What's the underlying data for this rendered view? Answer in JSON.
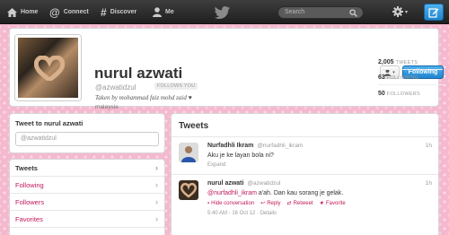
{
  "topbar": {
    "nav": [
      {
        "label": "Home",
        "icon": "home-icon"
      },
      {
        "label": "Connect",
        "icon": "at-icon"
      },
      {
        "label": "Discover",
        "icon": "hash-icon"
      },
      {
        "label": "Me",
        "icon": "person-icon"
      }
    ],
    "search_placeholder": "Search",
    "colors": {
      "bar": "#2b2b2b",
      "accent": "#1e84cd"
    }
  },
  "profile": {
    "name": "nurul azwati",
    "handle": "@azwatidzul",
    "follows_you": "FOLLOWS YOU",
    "bio": "Taken by mohammad faiz mohd zaid ♥",
    "location": "malaysia",
    "follow_label": "Following",
    "stats": [
      {
        "value": "2,005",
        "label": "TWEETS"
      },
      {
        "value": "63",
        "label": "FOLLOWING"
      },
      {
        "value": "50",
        "label": "FOLLOWERS"
      }
    ]
  },
  "tweet_to": {
    "title": "Tweet to nurul azwati",
    "placeholder": "@azwatidzul"
  },
  "sidenav": {
    "items": [
      {
        "label": "Tweets",
        "active": true
      },
      {
        "label": "Following",
        "active": false
      },
      {
        "label": "Followers",
        "active": false
      },
      {
        "label": "Favorites",
        "active": false
      }
    ],
    "link_color": "#c2185b"
  },
  "timeline": {
    "title": "Tweets",
    "tweets": [
      {
        "name": "Nurfadhli Ikram",
        "handle": "@nurfadhli_ikram",
        "time": "1h",
        "text": "Aku je ke layan bola ni?",
        "expand": "Expand"
      },
      {
        "name": "nurul azwati",
        "handle": "@azwatidzul",
        "time": "1h",
        "mention": "@nurfadhli_ikram",
        "text": " a'ah. Dan kau sorang je gelak.",
        "actions": {
          "hide": "Hide conversation",
          "reply": "Reply",
          "retweet": "Retweet",
          "favorite": "Favorite"
        },
        "meta": "5:40 AM - 16 Oct 12 · Details"
      }
    ]
  }
}
